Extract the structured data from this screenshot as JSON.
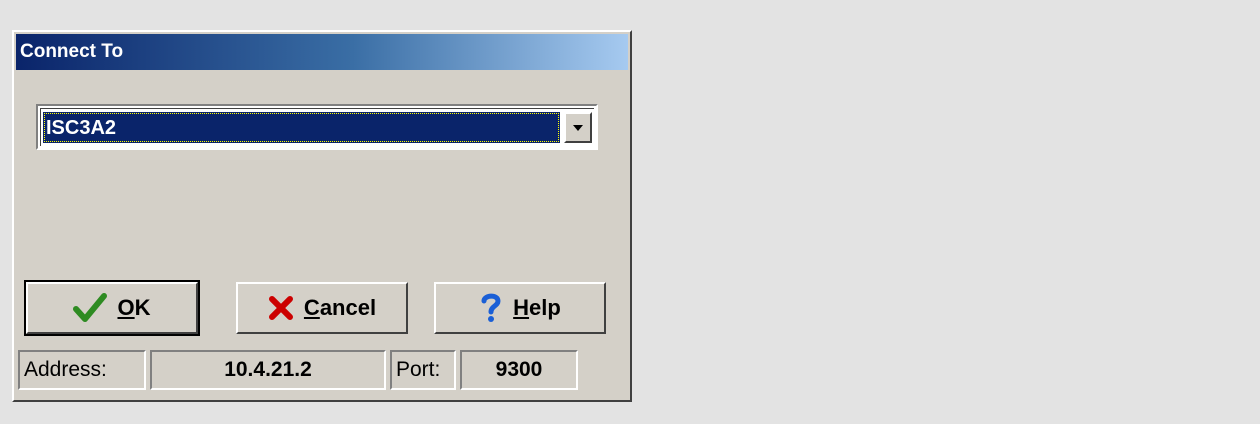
{
  "dialog": {
    "title": "Connect To"
  },
  "combo": {
    "selected": "ISC3A2"
  },
  "buttons": {
    "ok_prefix": "",
    "ok_underline": "O",
    "ok_rest": "K",
    "cancel_underline": "C",
    "cancel_rest": "ancel",
    "help_underline": "H",
    "help_rest": "elp"
  },
  "status": {
    "address_label": "Address:",
    "address_value": "10.4.21.2",
    "port_label": "Port:",
    "port_value": "9300"
  },
  "icons": {
    "ok": "checkmark-icon",
    "cancel": "x-icon",
    "help": "question-icon"
  },
  "colors": {
    "title_start": "#0a246a",
    "title_end": "#a6caf0",
    "selection": "#0a246a",
    "check": "#2e8b22",
    "x": "#cc0000",
    "question": "#1a5fd6"
  }
}
